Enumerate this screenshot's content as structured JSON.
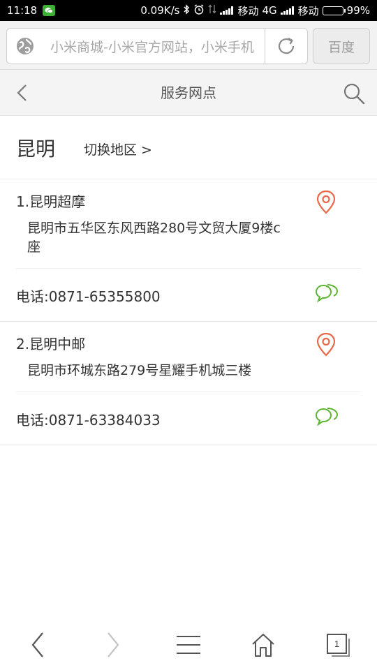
{
  "status_bar": {
    "time": "11:18",
    "speed": "0.09K/s",
    "carrier1": "移动",
    "network": "4G",
    "carrier2": "移动",
    "battery": "99%"
  },
  "browser": {
    "url_title": "小米商城-小米官方网站，小米手机",
    "search_engine": "百度"
  },
  "header": {
    "title": "服务网点"
  },
  "region": {
    "city": "昆明",
    "switch_label": "切换地区 >"
  },
  "stores": [
    {
      "name": "1.昆明超摩",
      "address": "昆明市五华区东风西路280号文贸大厦9楼c座",
      "phone": "电话:0871-65355800"
    },
    {
      "name": "2.昆明中邮",
      "address": "昆明市环城东路279号星耀手机城三楼",
      "phone": "电话:0871-63384033"
    }
  ],
  "bottom_nav": {
    "tab_count": "1"
  },
  "colors": {
    "pin": "#e8694a",
    "chat": "#5cb531"
  }
}
